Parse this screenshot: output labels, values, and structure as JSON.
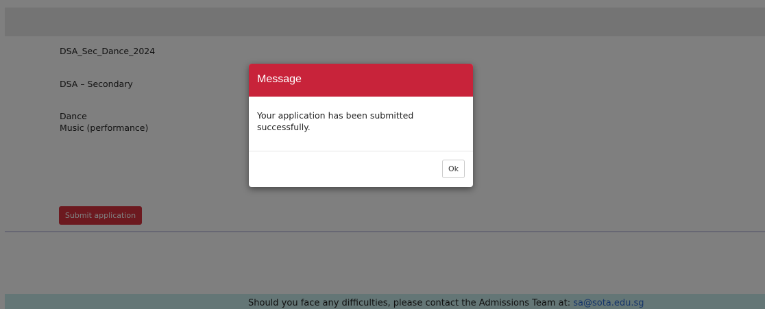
{
  "form": {
    "application_code": "DSA_Sec_Dance_2024",
    "application_type": "DSA – Secondary",
    "talent_areas": [
      "Dance",
      "Music (performance)"
    ],
    "submit_label": "Submit application"
  },
  "footer": {
    "text": "Should you face any difficulties, please contact the Admissions Team at: ",
    "email": "sa@sota.edu.sg"
  },
  "modal": {
    "title": "Message",
    "message": "Your application has been submitted successfully.",
    "ok_label": "Ok"
  },
  "colors": {
    "accent": "#c8233a",
    "button": "#d9323f",
    "footer_bg": "#c9ecec",
    "link": "#2a6ad4"
  }
}
